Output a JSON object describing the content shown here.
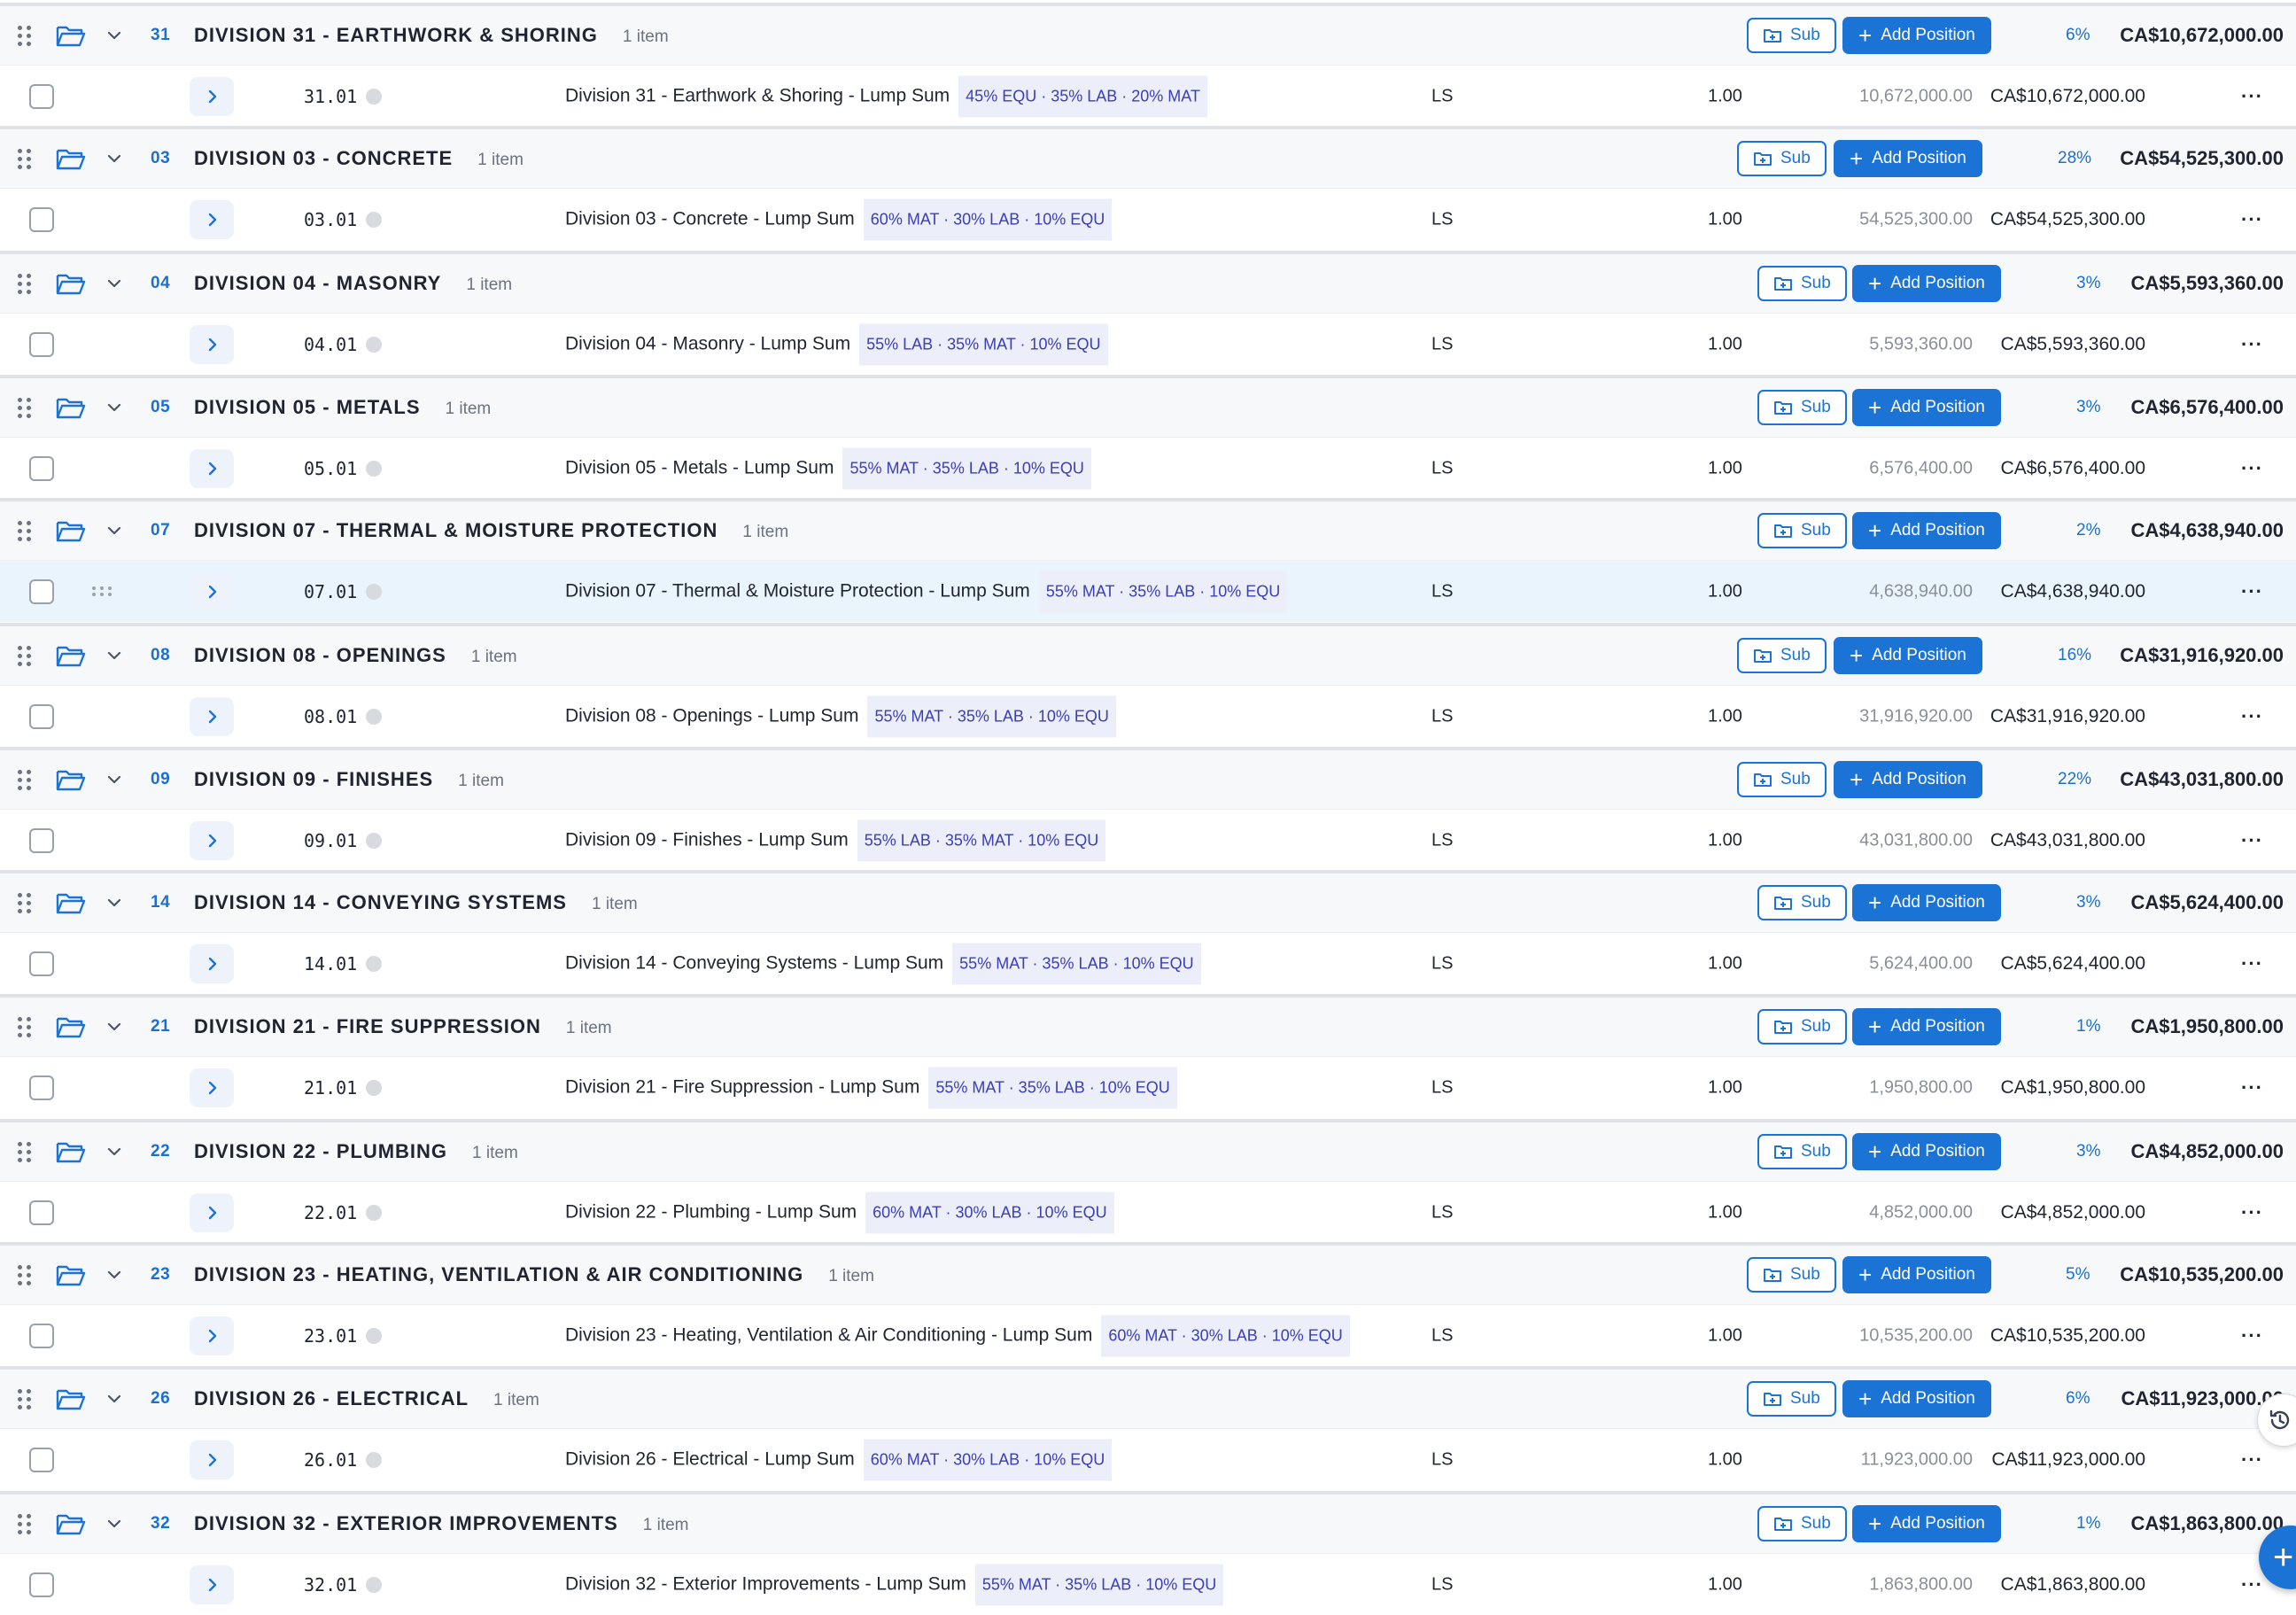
{
  "labels": {
    "sub": "Sub",
    "add_position": "Add Position",
    "unit": "LS",
    "quantity": "1.00",
    "more": "···"
  },
  "colors": {
    "accent": "#1b73d6",
    "highlight_row": "#eaf4fd",
    "badge_bg": "#eceef9"
  },
  "divisions": [
    {
      "code": "31",
      "title": "DIVISION 31 - EARTHWORK & SHORING",
      "count": "1 item",
      "pct": "6%",
      "total": "CA$10,672,000.00",
      "pos": {
        "code": "31.01",
        "desc": "Division 31 - Earthwork & Shoring - Lump Sum",
        "mix": "45% EQU · 35% LAB · 20% MAT",
        "unit_price": "10,672,000.00",
        "total": "CA$10,672,000.00"
      }
    },
    {
      "code": "03",
      "title": "DIVISION 03 - CONCRETE",
      "count": "1 item",
      "pct": "28%",
      "total": "CA$54,525,300.00",
      "pos": {
        "code": "03.01",
        "desc": "Division 03 - Concrete - Lump Sum",
        "mix": "60% MAT · 30% LAB · 10% EQU",
        "unit_price": "54,525,300.00",
        "total": "CA$54,525,300.00"
      }
    },
    {
      "code": "04",
      "title": "DIVISION 04 - MASONRY",
      "count": "1 item",
      "pct": "3%",
      "total": "CA$5,593,360.00",
      "pos": {
        "code": "04.01",
        "desc": "Division 04 - Masonry - Lump Sum",
        "mix": "55% LAB · 35% MAT · 10% EQU",
        "unit_price": "5,593,360.00",
        "total": "CA$5,593,360.00"
      }
    },
    {
      "code": "05",
      "title": "DIVISION 05 - METALS",
      "count": "1 item",
      "pct": "3%",
      "total": "CA$6,576,400.00",
      "pos": {
        "code": "05.01",
        "desc": "Division 05 - Metals - Lump Sum",
        "mix": "55% MAT · 35% LAB · 10% EQU",
        "unit_price": "6,576,400.00",
        "total": "CA$6,576,400.00"
      }
    },
    {
      "code": "07",
      "title": "DIVISION 07 - THERMAL & MOISTURE PROTECTION",
      "count": "1 item",
      "pct": "2%",
      "total": "CA$4,638,940.00",
      "highlight": true,
      "pos": {
        "code": "07.01",
        "desc": "Division 07 - Thermal & Moisture Protection - Lump Sum",
        "mix": "55% MAT · 35% LAB · 10% EQU",
        "unit_price": "4,638,940.00",
        "total": "CA$4,638,940.00"
      }
    },
    {
      "code": "08",
      "title": "DIVISION 08 - OPENINGS",
      "count": "1 item",
      "pct": "16%",
      "total": "CA$31,916,920.00",
      "pos": {
        "code": "08.01",
        "desc": "Division 08 - Openings - Lump Sum",
        "mix": "55% MAT · 35% LAB · 10% EQU",
        "unit_price": "31,916,920.00",
        "total": "CA$31,916,920.00"
      }
    },
    {
      "code": "09",
      "title": "DIVISION 09 - FINISHES",
      "count": "1 item",
      "pct": "22%",
      "total": "CA$43,031,800.00",
      "pos": {
        "code": "09.01",
        "desc": "Division 09 - Finishes - Lump Sum",
        "mix": "55% LAB · 35% MAT · 10% EQU",
        "unit_price": "43,031,800.00",
        "total": "CA$43,031,800.00"
      }
    },
    {
      "code": "14",
      "title": "DIVISION 14 - CONVEYING SYSTEMS",
      "count": "1 item",
      "pct": "3%",
      "total": "CA$5,624,400.00",
      "pos": {
        "code": "14.01",
        "desc": "Division 14 - Conveying Systems - Lump Sum",
        "mix": "55% MAT · 35% LAB · 10% EQU",
        "unit_price": "5,624,400.00",
        "total": "CA$5,624,400.00"
      }
    },
    {
      "code": "21",
      "title": "DIVISION 21 - FIRE SUPPRESSION",
      "count": "1 item",
      "pct": "1%",
      "total": "CA$1,950,800.00",
      "pos": {
        "code": "21.01",
        "desc": "Division 21 - Fire Suppression - Lump Sum",
        "mix": "55% MAT · 35% LAB · 10% EQU",
        "unit_price": "1,950,800.00",
        "total": "CA$1,950,800.00"
      }
    },
    {
      "code": "22",
      "title": "DIVISION 22 - PLUMBING",
      "count": "1 item",
      "pct": "3%",
      "total": "CA$4,852,000.00",
      "pos": {
        "code": "22.01",
        "desc": "Division 22 - Plumbing - Lump Sum",
        "mix": "60% MAT · 30% LAB · 10% EQU",
        "unit_price": "4,852,000.00",
        "total": "CA$4,852,000.00"
      }
    },
    {
      "code": "23",
      "title": "DIVISION 23 - HEATING, VENTILATION & AIR CONDITIONING",
      "count": "1 item",
      "pct": "5%",
      "total": "CA$10,535,200.00",
      "pos": {
        "code": "23.01",
        "desc": "Division 23 - Heating, Ventilation & Air Conditioning - Lump Sum",
        "mix": "60% MAT · 30% LAB · 10% EQU",
        "unit_price": "10,535,200.00",
        "total": "CA$10,535,200.00"
      }
    },
    {
      "code": "26",
      "title": "DIVISION 26 - ELECTRICAL",
      "count": "1 item",
      "pct": "6%",
      "total": "CA$11,923,000.00",
      "pos": {
        "code": "26.01",
        "desc": "Division 26 - Electrical - Lump Sum",
        "mix": "60% MAT · 30% LAB · 10% EQU",
        "unit_price": "11,923,000.00",
        "total": "CA$11,923,000.00"
      }
    },
    {
      "code": "32",
      "title": "DIVISION 32 - EXTERIOR IMPROVEMENTS",
      "count": "1 item",
      "pct": "1%",
      "total": "CA$1,863,800.00",
      "pos": {
        "code": "32.01",
        "desc": "Division 32 - Exterior Improvements - Lump Sum",
        "mix": "55% MAT · 35% LAB · 10% EQU",
        "unit_price": "1,863,800.00",
        "total": "CA$1,863,800.00"
      }
    }
  ]
}
